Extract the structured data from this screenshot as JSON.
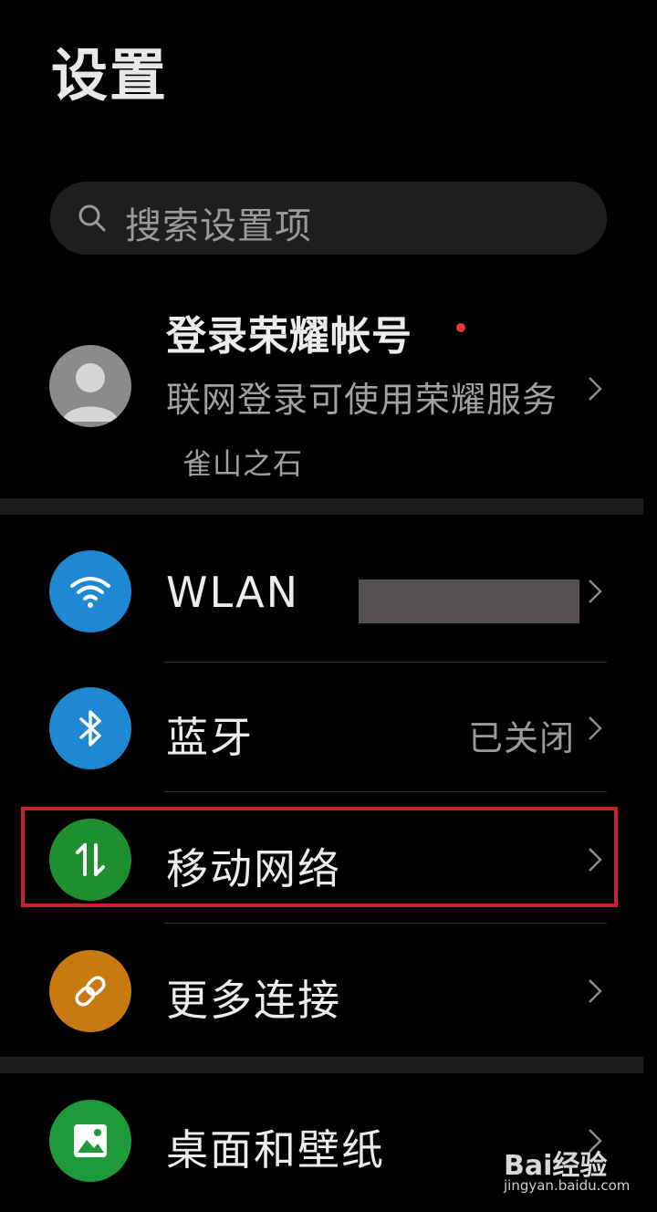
{
  "header": {
    "title": "设置"
  },
  "search": {
    "placeholder": "搜索设置项",
    "icon": "search-icon"
  },
  "account": {
    "name": "登录荣耀帐号",
    "description": "联网登录可使用荣耀服务",
    "username": "雀山之石",
    "notification_color": "#e53935"
  },
  "settings": {
    "wlan": {
      "label": "WLAN",
      "value": "",
      "icon": "wifi-icon",
      "color": "#1e88d3"
    },
    "bluetooth": {
      "label": "蓝牙",
      "value": "已关闭",
      "icon": "bluetooth-icon",
      "color": "#1e88d3"
    },
    "mobile_network": {
      "label": "移动网络",
      "icon": "mobile-data-icon",
      "color": "#1e8f2f",
      "highlighted": true
    },
    "more_connections": {
      "label": "更多连接",
      "icon": "link-icon",
      "color": "#c77a12"
    },
    "wallpaper": {
      "label": "桌面和壁纸",
      "icon": "image-icon",
      "color": "#1e9a3a"
    }
  },
  "watermark": {
    "brand": "Bai经验",
    "url": "jingyan.baidu.com"
  }
}
